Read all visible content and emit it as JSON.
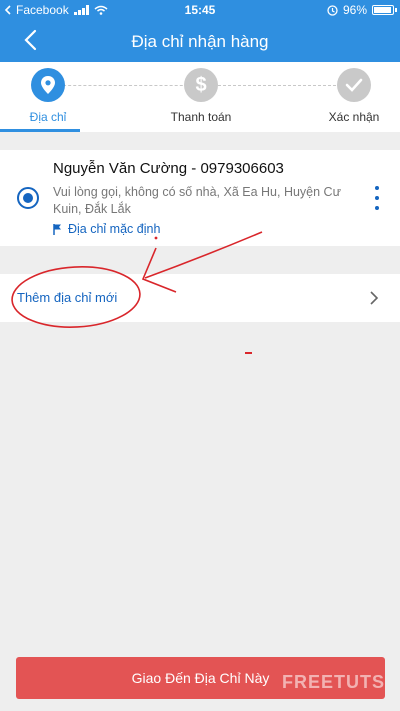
{
  "status_bar": {
    "carrier": "Facebook",
    "time": "15:45",
    "battery": "96%"
  },
  "header": {
    "title": "Địa chỉ nhận hàng"
  },
  "steps": [
    {
      "label": "Địa chỉ",
      "icon": "location-pin-icon",
      "active": true
    },
    {
      "label": "Thanh toán",
      "icon": "dollar-icon",
      "active": false
    },
    {
      "label": "Xác nhận",
      "icon": "check-icon",
      "active": false
    }
  ],
  "address": {
    "name_phone": "Nguyễn Văn Cường - 0979306603",
    "detail": "Vui lòng gọi, không có số nhà, Xã Ea Hu, Huyện Cư Kuin, Đắk Lắk",
    "default_label": "Địa chỉ mặc định",
    "selected": true
  },
  "add_address": {
    "label": "Thêm địa chỉ mới"
  },
  "footer": {
    "button_label": "Giao Đến Địa Chỉ Này"
  },
  "watermark": "FREETUTS",
  "colors": {
    "header": "#2f8fe0",
    "accent": "#1565c0",
    "button": "#e35454",
    "annotation": "#d9262b"
  }
}
